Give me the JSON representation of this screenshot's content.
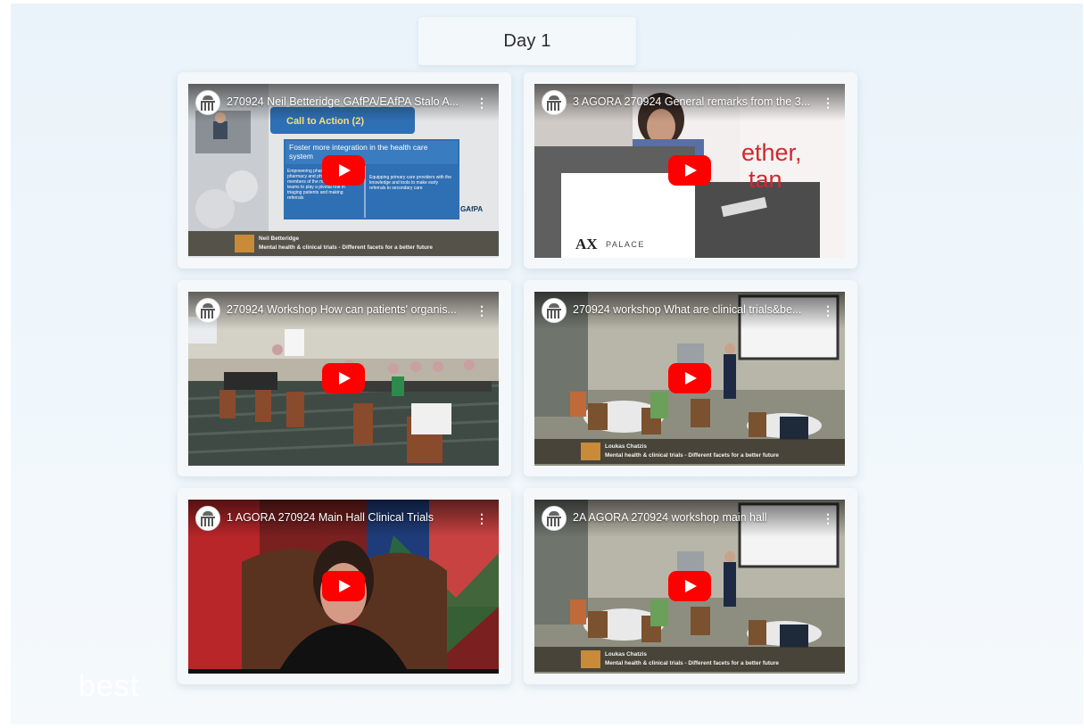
{
  "section": {
    "title": "Day 1"
  },
  "videos": [
    {
      "title": "270924 Neil Betteridge GAfPA/EAfPA Stalo A...",
      "lower_line1": "Neil Betteridge",
      "lower_line2": "Mental health & clinical trials - Different facets for a better future",
      "slide": {
        "heading": "Call to Action (2)",
        "main": "Foster more integration in the health care system",
        "left": "Empowering pharmacists and pharmacy and physicians and other members of the multidisciplinary teams to play a pivotal role in triaging patients and making referrals",
        "right": "Equipping primary care providers with the knowledge and tools to make early referrals to secondary care",
        "brand": "GAfPA"
      }
    },
    {
      "title": "3 AGORA 270924 General remarks from the 3...",
      "backdrop_text": [
        "ether,",
        "tan"
      ],
      "podium_brand": "AX",
      "podium_name": "PALACE"
    },
    {
      "title": "270924 Workshop How can patients' organis..."
    },
    {
      "title": "270924 workshop What are clinical trials&be...",
      "lower_line1": "Loukas Chatzis",
      "lower_line2": "Mental health & clinical trials - Different facets for a better future"
    },
    {
      "title": "1 AGORA 270924 Main Hall Clinical Trials"
    },
    {
      "title": "2A AGORA 270924 workshop main hall",
      "lower_line1": "Loukas Chatzis",
      "lower_line2": "Mental health & clinical trials - Different facets for a better future"
    }
  ],
  "watermark": "best",
  "colors": {
    "play_button": "#ff0000",
    "slide_blue": "#2f6fb3"
  },
  "icons": [
    "channel-logo-icon",
    "more-options-icon",
    "play-icon"
  ]
}
